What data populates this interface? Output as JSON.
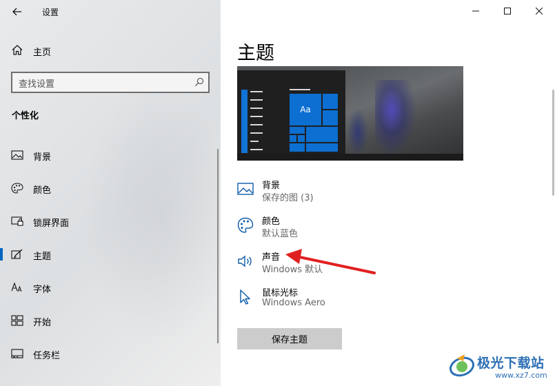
{
  "window": {
    "title": "设置"
  },
  "sidebar": {
    "home_label": "主页",
    "search_placeholder": "查找设置",
    "section_title": "个性化",
    "items": [
      {
        "label": "背景",
        "icon": "picture-icon"
      },
      {
        "label": "颜色",
        "icon": "palette-icon"
      },
      {
        "label": "锁屏界面",
        "icon": "lock-screen-icon"
      },
      {
        "label": "主题",
        "icon": "theme-brush-icon",
        "selected": true
      },
      {
        "label": "字体",
        "icon": "font-icon"
      },
      {
        "label": "开始",
        "icon": "start-icon"
      },
      {
        "label": "任务栏",
        "icon": "taskbar-icon"
      }
    ]
  },
  "main": {
    "title": "主题",
    "preview_tile_text": "Aa",
    "settings": [
      {
        "title": "背景",
        "subtitle": "保存的图 (3)",
        "icon": "picture-icon"
      },
      {
        "title": "颜色",
        "subtitle": "默认蓝色",
        "icon": "palette-icon"
      },
      {
        "title": "声音",
        "subtitle": "Windows 默认",
        "icon": "speaker-icon"
      },
      {
        "title": "鼠标光标",
        "subtitle": "Windows Aero",
        "icon": "cursor-icon"
      }
    ],
    "save_button": "保存主题"
  },
  "annotation": {
    "color": "#e02020"
  },
  "watermark": {
    "brand": "极光下载站",
    "url": "www.xz7.com"
  },
  "colors": {
    "accent": "#0067c0",
    "tile_blue": "#0c6fd1"
  }
}
